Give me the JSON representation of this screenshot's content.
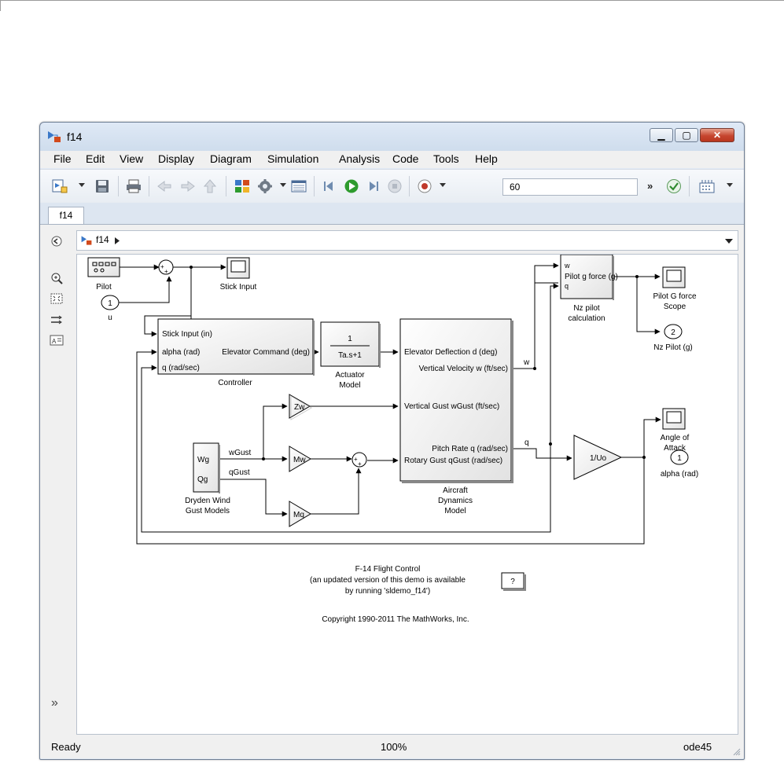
{
  "window": {
    "title": "f14"
  },
  "menu": [
    "File",
    "Edit",
    "View",
    "Display",
    "Diagram",
    "Simulation",
    "Analysis",
    "Code",
    "Tools",
    "Help"
  ],
  "toolbar": {
    "stop_time": "60",
    "more": "»"
  },
  "tabs": [
    "f14"
  ],
  "breadcrumb": {
    "model": "f14"
  },
  "diagram": {
    "pilot": "Pilot",
    "stick_input": "Stick Input",
    "inport_u_num": "1",
    "inport_u_label": "u",
    "controller": {
      "in1": "Stick Input (in)",
      "in2": "alpha (rad)",
      "out": "Elevator Command (deg)",
      "in3": "q (rad/sec)",
      "name": "Controller"
    },
    "actuator": {
      "num": "1",
      "den": "Ta.s+1",
      "name1": "Actuator",
      "name2": "Model"
    },
    "aircraft": {
      "in1": "Elevator Deflection d (deg)",
      "out1": "Vertical Velocity w (ft/sec)",
      "in2": "Vertical Gust wGust (ft/sec)",
      "out2": "Pitch Rate q (rad/sec)",
      "in3": "Rotary Gust qGust (rad/sec)",
      "name1": "Aircraft",
      "name2": "Dynamics",
      "name3": "Model"
    },
    "nz_calc": {
      "in1": "w",
      "out": "Pilot g force (g)",
      "in2": "q",
      "name1": "Nz pilot",
      "name2": "calculation"
    },
    "pilot_scope": {
      "name1": "Pilot G force",
      "name2": "Scope"
    },
    "nz_out": {
      "num": "2",
      "label": "Nz Pilot (g)"
    },
    "aoa_scope": {
      "name1": "Angle of",
      "name2": "Attack"
    },
    "alpha_out": {
      "num": "1",
      "label": "alpha (rad)"
    },
    "gain_uo": "1/Uo",
    "zw": "Zw",
    "mw": "Mw",
    "mq": "Mq",
    "dryden": {
      "wg": "Wg",
      "qg": "Qg",
      "name1": "Dryden Wind",
      "name2": "Gust Models"
    },
    "sig_wgust": "wGust",
    "sig_qgust": "qGust",
    "sig_w": "w",
    "sig_q": "q",
    "note1": "F-14 Flight Control",
    "note2": "(an updated version of this demo is available",
    "note3": "by running 'sldemo_f14')",
    "help_btn": "?",
    "copyright": "Copyright 1990-2011 The MathWorks, Inc."
  },
  "status": {
    "left": "Ready",
    "zoom": "100%",
    "solver": "ode45"
  },
  "colors": {
    "sum_plus": "+",
    "accent_green": "#2e9b2e",
    "record_red": "#c0392b"
  }
}
